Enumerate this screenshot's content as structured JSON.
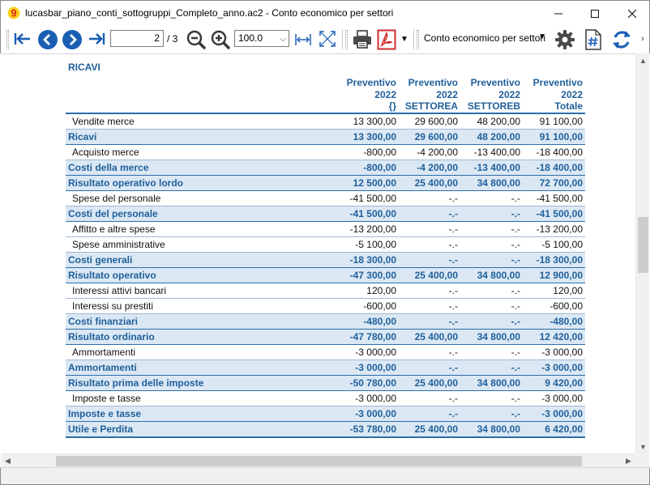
{
  "window": {
    "title": "lucasbar_piano_conti_sottogruppi_Completo_anno.ac2 - Conto economico per settori"
  },
  "toolbar": {
    "page_current": "2",
    "page_total": "/ 3",
    "zoom_value": "100.0",
    "report_name": "Conto economico per settori"
  },
  "report": {
    "section_title": "RICAVI",
    "columns": [
      {
        "line1": "",
        "line2": "",
        "line3": ""
      },
      {
        "line1": "Preventivo",
        "line2": "2022",
        "line3": "{}"
      },
      {
        "line1": "Preventivo",
        "line2": "2022",
        "line3": "SETTOREA"
      },
      {
        "line1": "Preventivo",
        "line2": "2022",
        "line3": "SETTOREB"
      },
      {
        "line1": "Preventivo",
        "line2": "2022",
        "line3": "Totale"
      }
    ],
    "rows": [
      {
        "type": "det",
        "label": "Vendite merce",
        "v": [
          "13 300,00",
          "29 600,00",
          "48 200,00",
          "91 100,00"
        ]
      },
      {
        "type": "tot",
        "label": "Ricavi",
        "v": [
          "13 300,00",
          "29 600,00",
          "48 200,00",
          "91 100,00"
        ]
      },
      {
        "type": "det",
        "label": "Acquisto merce",
        "v": [
          "-800,00",
          "-4 200,00",
          "-13 400,00",
          "-18 400,00"
        ]
      },
      {
        "type": "tot",
        "label": "Costi della merce",
        "v": [
          "-800,00",
          "-4 200,00",
          "-13 400,00",
          "-18 400,00"
        ]
      },
      {
        "type": "tot",
        "label": "Risultato operativo lordo",
        "v": [
          "12 500,00",
          "25 400,00",
          "34 800,00",
          "72 700,00"
        ]
      },
      {
        "type": "det",
        "label": "Spese del personale",
        "v": [
          "-41 500,00",
          "-.-",
          "-.-",
          "-41 500,00"
        ]
      },
      {
        "type": "tot",
        "label": "Costi del personale",
        "v": [
          "-41 500,00",
          "-.-",
          "-.-",
          "-41 500,00"
        ]
      },
      {
        "type": "det",
        "label": "Affitto e altre spese",
        "v": [
          "-13 200,00",
          "-.-",
          "-.-",
          "-13 200,00"
        ]
      },
      {
        "type": "det",
        "label": "Spese amministrative",
        "v": [
          "-5 100,00",
          "-.-",
          "-.-",
          "-5 100,00"
        ]
      },
      {
        "type": "tot",
        "label": "Costi generali",
        "v": [
          "-18 300,00",
          "-.-",
          "-.-",
          "-18 300,00"
        ]
      },
      {
        "type": "tot",
        "label": "Risultato operativo",
        "v": [
          "-47 300,00",
          "25 400,00",
          "34 800,00",
          "12 900,00"
        ]
      },
      {
        "type": "det",
        "label": "Interessi attivi bancari",
        "v": [
          "120,00",
          "-.-",
          "-.-",
          "120,00"
        ]
      },
      {
        "type": "det",
        "label": "Interessi su prestiti",
        "v": [
          "-600,00",
          "-.-",
          "-.-",
          "-600,00"
        ]
      },
      {
        "type": "tot",
        "label": "Costi finanziari",
        "v": [
          "-480,00",
          "-.-",
          "-.-",
          "-480,00"
        ]
      },
      {
        "type": "tot",
        "label": "Risultato ordinario",
        "v": [
          "-47 780,00",
          "25 400,00",
          "34 800,00",
          "12 420,00"
        ]
      },
      {
        "type": "det",
        "label": "Ammortamenti",
        "v": [
          "-3 000,00",
          "-.-",
          "-.-",
          "-3 000,00"
        ]
      },
      {
        "type": "tot",
        "label": "Ammortamenti",
        "v": [
          "-3 000,00",
          "-.-",
          "-.-",
          "-3 000,00"
        ]
      },
      {
        "type": "tot",
        "label": "Risultato prima delle imposte",
        "v": [
          "-50 780,00",
          "25 400,00",
          "34 800,00",
          "9 420,00"
        ]
      },
      {
        "type": "det",
        "label": "Imposte e tasse",
        "v": [
          "-3 000,00",
          "-.-",
          "-.-",
          "-3 000,00"
        ]
      },
      {
        "type": "tot",
        "label": "Imposte e tasse",
        "v": [
          "-3 000,00",
          "-.-",
          "-.-",
          "-3 000,00"
        ]
      },
      {
        "type": "tot",
        "label": "Utile e Perdita",
        "v": [
          "-53 780,00",
          "25 400,00",
          "34 800,00",
          "6 420,00"
        ]
      }
    ]
  },
  "colors": {
    "accent": "#1f5f9a",
    "total_row_bg": "#dbe8f4",
    "nav_blue": "#1a5fb4",
    "pdf_red": "#d22b2b"
  }
}
